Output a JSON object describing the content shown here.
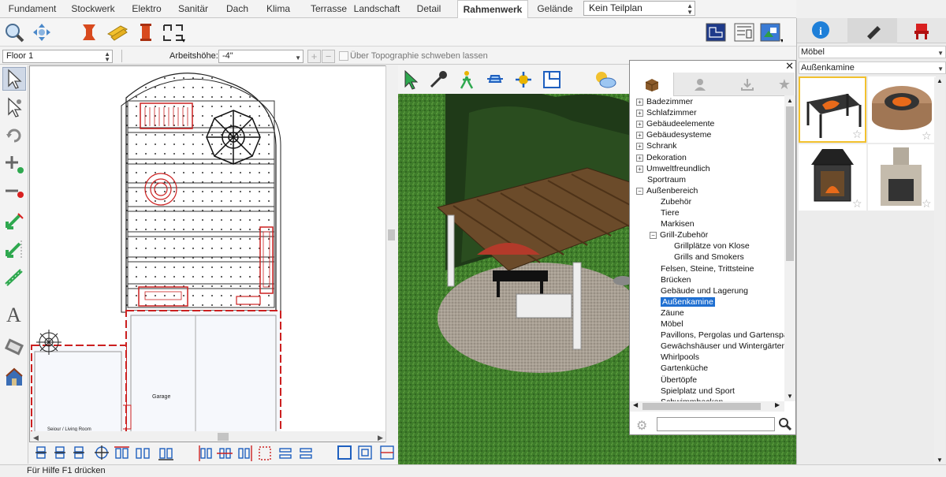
{
  "tabs": [
    "Fundament",
    "Stockwerk",
    "Elektro",
    "Sanitär",
    "Dach",
    "Klima",
    "Terrasse",
    "Landschaft",
    "Detail",
    "Rahmenwerk",
    "Gelände"
  ],
  "active_tab": "Rahmenwerk",
  "teilplan_select": "Kein Teilplan",
  "floor_select": "Floor 1",
  "arbeitshoehe_label": "Arbeitshöhe:",
  "arbeitshoehe_value": "-4\"",
  "topo_checkbox_label": "Über Topographie schweben lassen",
  "plan_labels": {
    "garage": "Garage",
    "living": "Seiour / Living Room"
  },
  "library": {
    "tabs": [
      "package-icon",
      "person-icon",
      "download-icon",
      "star-icon"
    ],
    "tree": [
      {
        "label": "Badezimmer",
        "level": 0,
        "expand": "+"
      },
      {
        "label": "Schlafzimmer",
        "level": 0,
        "expand": "+"
      },
      {
        "label": "Gebäudeelemente",
        "level": 0,
        "expand": "+"
      },
      {
        "label": "Gebäudesysteme",
        "level": 0,
        "expand": "+"
      },
      {
        "label": "Schrank",
        "level": 0,
        "expand": "+"
      },
      {
        "label": "Dekoration",
        "level": 0,
        "expand": "+"
      },
      {
        "label": "Umweltfreundlich",
        "level": 0,
        "expand": "+"
      },
      {
        "label": "Sportraum",
        "level": 0,
        "expand": ""
      },
      {
        "label": "Außenbereich",
        "level": 0,
        "expand": "-"
      },
      {
        "label": "Zubehör",
        "level": 1,
        "expand": ""
      },
      {
        "label": "Tiere",
        "level": 1,
        "expand": ""
      },
      {
        "label": "Markisen",
        "level": 1,
        "expand": ""
      },
      {
        "label": "Grill-Zubehör",
        "level": 1,
        "expand": "-"
      },
      {
        "label": "Grillplätze von Klose",
        "level": 2,
        "expand": ""
      },
      {
        "label": "Grills and Smokers",
        "level": 2,
        "expand": ""
      },
      {
        "label": "Felsen, Steine, Trittsteine",
        "level": 1,
        "expand": ""
      },
      {
        "label": "Brücken",
        "level": 1,
        "expand": ""
      },
      {
        "label": "Gebäude und Lagerung",
        "level": 1,
        "expand": ""
      },
      {
        "label": "Außenkamine",
        "level": 1,
        "expand": "",
        "selected": true
      },
      {
        "label": "Zäune",
        "level": 1,
        "expand": ""
      },
      {
        "label": "Möbel",
        "level": 1,
        "expand": ""
      },
      {
        "label": "Pavillons, Pergolas und Gartenspal",
        "level": 1,
        "expand": ""
      },
      {
        "label": "Gewächshäuser und Wintergärten",
        "level": 1,
        "expand": ""
      },
      {
        "label": "Whirlpools",
        "level": 1,
        "expand": ""
      },
      {
        "label": "Gartenküche",
        "level": 1,
        "expand": ""
      },
      {
        "label": "Übertöpfe",
        "level": 1,
        "expand": ""
      },
      {
        "label": "Spielplatz und Sport",
        "level": 1,
        "expand": ""
      },
      {
        "label": "Schwimmbecken",
        "level": 1,
        "expand": ""
      }
    ],
    "search_placeholder": ""
  },
  "right_panel": {
    "tabs": [
      "info-icon",
      "pen-icon",
      "chair-icon"
    ],
    "category_select": "Möbel",
    "subcategory_select": "Außenkamine",
    "thumbnails": [
      "fire-pit-square",
      "fire-pit-round",
      "chimenea",
      "outdoor-fireplace"
    ]
  },
  "status": "Für Hilfe F1 drücken",
  "colors": {
    "selection": "#1f6fd1",
    "grass": "#3d7a2a",
    "plan_red": "#cc2020"
  }
}
